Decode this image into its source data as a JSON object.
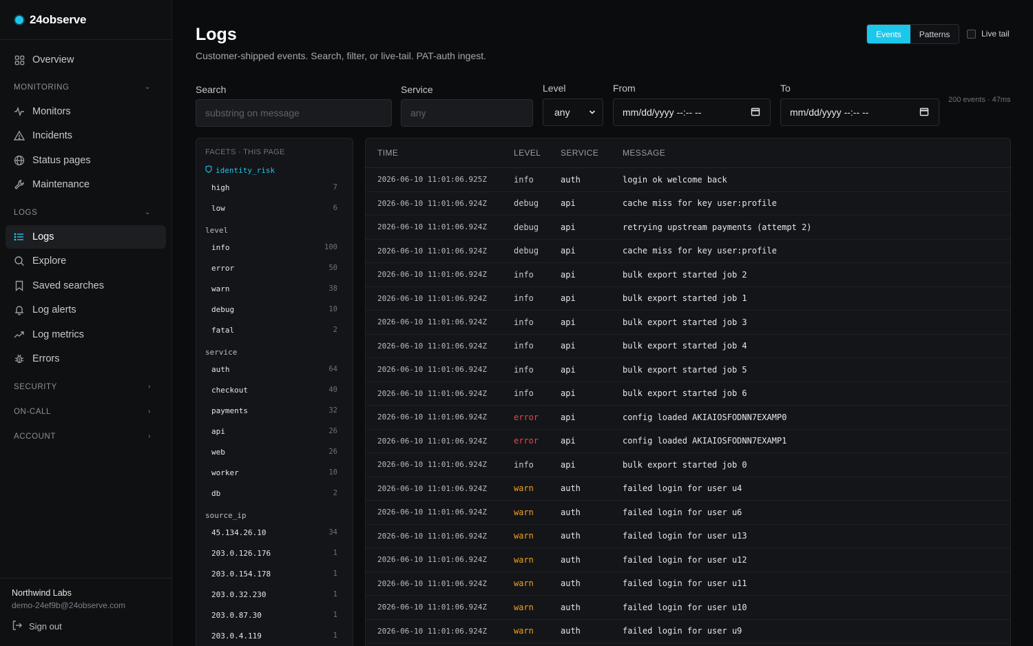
{
  "brand": {
    "name": "24observe",
    "accent": "#1cc7ec"
  },
  "nav": {
    "overview": "Overview",
    "monitoring_label": "MONITORING",
    "monitors": "Monitors",
    "incidents": "Incidents",
    "status_pages": "Status pages",
    "maintenance": "Maintenance",
    "logs_label": "LOGS",
    "logs": "Logs",
    "explore": "Explore",
    "saved_searches": "Saved searches",
    "log_alerts": "Log alerts",
    "log_metrics": "Log metrics",
    "errors": "Errors",
    "security_label": "SECURITY",
    "oncall_label": "ON-CALL",
    "account_label": "ACCOUNT"
  },
  "footer": {
    "org": "Northwind Labs",
    "email": "demo-24ef9b@24observe.com",
    "signout": "Sign out"
  },
  "page": {
    "title": "Logs",
    "subtitle": "Customer-shipped events. Search, filter, or live-tail. PAT-auth ingest.",
    "tabs": {
      "events": "Events",
      "patterns": "Patterns"
    },
    "live_tail": "Live tail"
  },
  "filters": {
    "search_label": "Search",
    "search_placeholder": "substring on message",
    "service_label": "Service",
    "service_placeholder": "any",
    "level_label": "Level",
    "level_value": "any",
    "from_label": "From",
    "from_value": "mm/dd/yyyy --:-- --",
    "to_label": "To",
    "to_value": "mm/dd/yyyy --:-- --",
    "meta": "200 events · 47ms"
  },
  "facets": {
    "header": "FACETS · THIS PAGE",
    "identity_risk": {
      "name": "identity_risk",
      "items": [
        {
          "k": "high",
          "n": "7"
        },
        {
          "k": "low",
          "n": "6"
        }
      ]
    },
    "level": {
      "name": "level",
      "items": [
        {
          "k": "info",
          "n": "100"
        },
        {
          "k": "error",
          "n": "50"
        },
        {
          "k": "warn",
          "n": "38"
        },
        {
          "k": "debug",
          "n": "10"
        },
        {
          "k": "fatal",
          "n": "2"
        }
      ]
    },
    "service": {
      "name": "service",
      "items": [
        {
          "k": "auth",
          "n": "64"
        },
        {
          "k": "checkout",
          "n": "40"
        },
        {
          "k": "payments",
          "n": "32"
        },
        {
          "k": "api",
          "n": "26"
        },
        {
          "k": "web",
          "n": "26"
        },
        {
          "k": "worker",
          "n": "10"
        },
        {
          "k": "db",
          "n": "2"
        }
      ]
    },
    "source_ip": {
      "name": "source_ip",
      "items": [
        {
          "k": "45.134.26.10",
          "n": "34"
        },
        {
          "k": "203.0.126.176",
          "n": "1"
        },
        {
          "k": "203.0.154.178",
          "n": "1"
        },
        {
          "k": "203.0.32.230",
          "n": "1"
        },
        {
          "k": "203.0.87.30",
          "n": "1"
        },
        {
          "k": "203.0.4.119",
          "n": "1"
        }
      ]
    }
  },
  "table": {
    "headers": {
      "time": "TIME",
      "level": "LEVEL",
      "service": "SERVICE",
      "message": "MESSAGE"
    },
    "rows": [
      {
        "time": "2026-06-10 11:01:06.925Z",
        "level": "info",
        "service": "auth",
        "message": "login ok welcome back"
      },
      {
        "time": "2026-06-10 11:01:06.924Z",
        "level": "debug",
        "service": "api",
        "message": "cache miss for key user:profile"
      },
      {
        "time": "2026-06-10 11:01:06.924Z",
        "level": "debug",
        "service": "api",
        "message": "retrying upstream payments (attempt 2)"
      },
      {
        "time": "2026-06-10 11:01:06.924Z",
        "level": "debug",
        "service": "api",
        "message": "cache miss for key user:profile"
      },
      {
        "time": "2026-06-10 11:01:06.924Z",
        "level": "info",
        "service": "api",
        "message": "bulk export started job 2"
      },
      {
        "time": "2026-06-10 11:01:06.924Z",
        "level": "info",
        "service": "api",
        "message": "bulk export started job 1"
      },
      {
        "time": "2026-06-10 11:01:06.924Z",
        "level": "info",
        "service": "api",
        "message": "bulk export started job 3"
      },
      {
        "time": "2026-06-10 11:01:06.924Z",
        "level": "info",
        "service": "api",
        "message": "bulk export started job 4"
      },
      {
        "time": "2026-06-10 11:01:06.924Z",
        "level": "info",
        "service": "api",
        "message": "bulk export started job 5"
      },
      {
        "time": "2026-06-10 11:01:06.924Z",
        "level": "info",
        "service": "api",
        "message": "bulk export started job 6"
      },
      {
        "time": "2026-06-10 11:01:06.924Z",
        "level": "error",
        "service": "api",
        "message": "config loaded AKIAIOSFODNN7EXAMP0"
      },
      {
        "time": "2026-06-10 11:01:06.924Z",
        "level": "error",
        "service": "api",
        "message": "config loaded AKIAIOSFODNN7EXAMP1"
      },
      {
        "time": "2026-06-10 11:01:06.924Z",
        "level": "info",
        "service": "api",
        "message": "bulk export started job 0"
      },
      {
        "time": "2026-06-10 11:01:06.924Z",
        "level": "warn",
        "service": "auth",
        "message": "failed login for user u4"
      },
      {
        "time": "2026-06-10 11:01:06.924Z",
        "level": "warn",
        "service": "auth",
        "message": "failed login for user u6"
      },
      {
        "time": "2026-06-10 11:01:06.924Z",
        "level": "warn",
        "service": "auth",
        "message": "failed login for user u13"
      },
      {
        "time": "2026-06-10 11:01:06.924Z",
        "level": "warn",
        "service": "auth",
        "message": "failed login for user u12"
      },
      {
        "time": "2026-06-10 11:01:06.924Z",
        "level": "warn",
        "service": "auth",
        "message": "failed login for user u11"
      },
      {
        "time": "2026-06-10 11:01:06.924Z",
        "level": "warn",
        "service": "auth",
        "message": "failed login for user u10"
      },
      {
        "time": "2026-06-10 11:01:06.924Z",
        "level": "warn",
        "service": "auth",
        "message": "failed login for user u9"
      }
    ]
  },
  "colors": {
    "error": "#e5484d",
    "warn": "#f0a020",
    "accent": "#1cc7ec"
  }
}
